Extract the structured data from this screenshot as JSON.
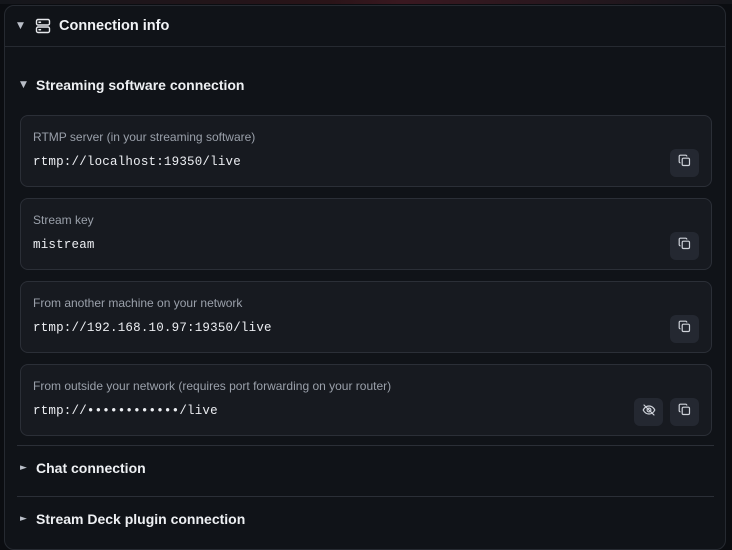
{
  "panel": {
    "title": "Connection info",
    "expanded": true,
    "icon": "server-icon"
  },
  "sections": {
    "streaming": {
      "title": "Streaming software connection",
      "expanded": true,
      "fields": [
        {
          "label": "RTMP server (in your streaming software)",
          "value": "rtmp://localhost:19350/live",
          "actions": [
            "copy"
          ]
        },
        {
          "label": "Stream key",
          "value": "mistream",
          "actions": [
            "copy"
          ]
        },
        {
          "label": "From another machine on your network",
          "value": "rtmp://192.168.10.97:19350/live",
          "actions": [
            "copy"
          ]
        },
        {
          "label": "From outside your network (requires port forwarding on your router)",
          "value": "rtmp://••••••••••••/live",
          "actions": [
            "toggle-visibility",
            "copy"
          ]
        }
      ]
    },
    "chat": {
      "title": "Chat connection",
      "expanded": false
    },
    "streamdeck": {
      "title": "Stream Deck plugin connection",
      "expanded": false
    }
  },
  "colors": {
    "background": "#0b0d11",
    "panel": "#101318",
    "card": "#171a20",
    "border": "#2b2f37",
    "button": "#242831",
    "label": "#9aa0aa",
    "text": "#eceef2"
  }
}
